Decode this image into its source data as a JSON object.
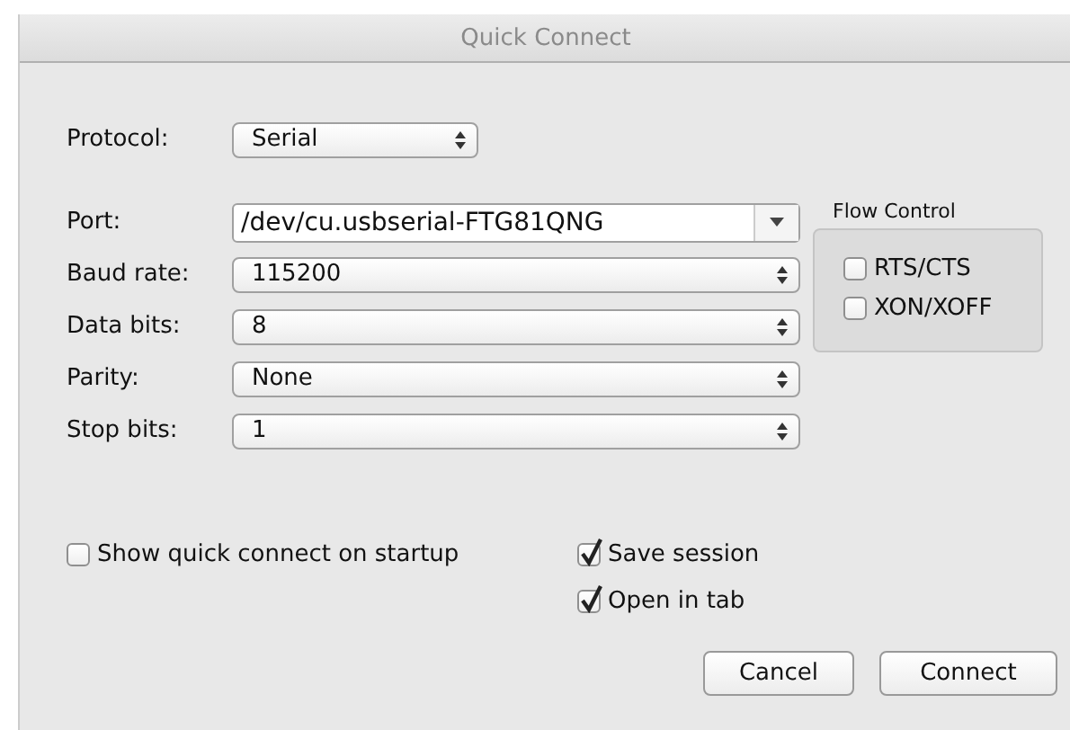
{
  "window": {
    "title": "Quick Connect"
  },
  "protocol": {
    "label": "Protocol:",
    "value": "Serial"
  },
  "fields": [
    {
      "kind": "combo",
      "label": "Port:",
      "value": "/dev/cu.usbserial-FTG81QNG"
    },
    {
      "kind": "select",
      "label": "Baud rate:",
      "value": "115200"
    },
    {
      "kind": "select",
      "label": "Data bits:",
      "value": "8"
    },
    {
      "kind": "select",
      "label": "Parity:",
      "value": "None"
    },
    {
      "kind": "select",
      "label": "Stop bits:",
      "value": "1"
    }
  ],
  "flow_control": {
    "title": "Flow Control",
    "options": [
      {
        "label": "RTS/CTS",
        "checked": false
      },
      {
        "label": "XON/XOFF",
        "checked": false
      }
    ]
  },
  "options_left": [
    {
      "label": "Show quick connect on startup",
      "checked": false
    }
  ],
  "options_right": [
    {
      "label": "Save session",
      "checked": true
    },
    {
      "label": "Open in tab",
      "checked": true
    }
  ],
  "buttons": [
    "Cancel",
    "Connect"
  ]
}
